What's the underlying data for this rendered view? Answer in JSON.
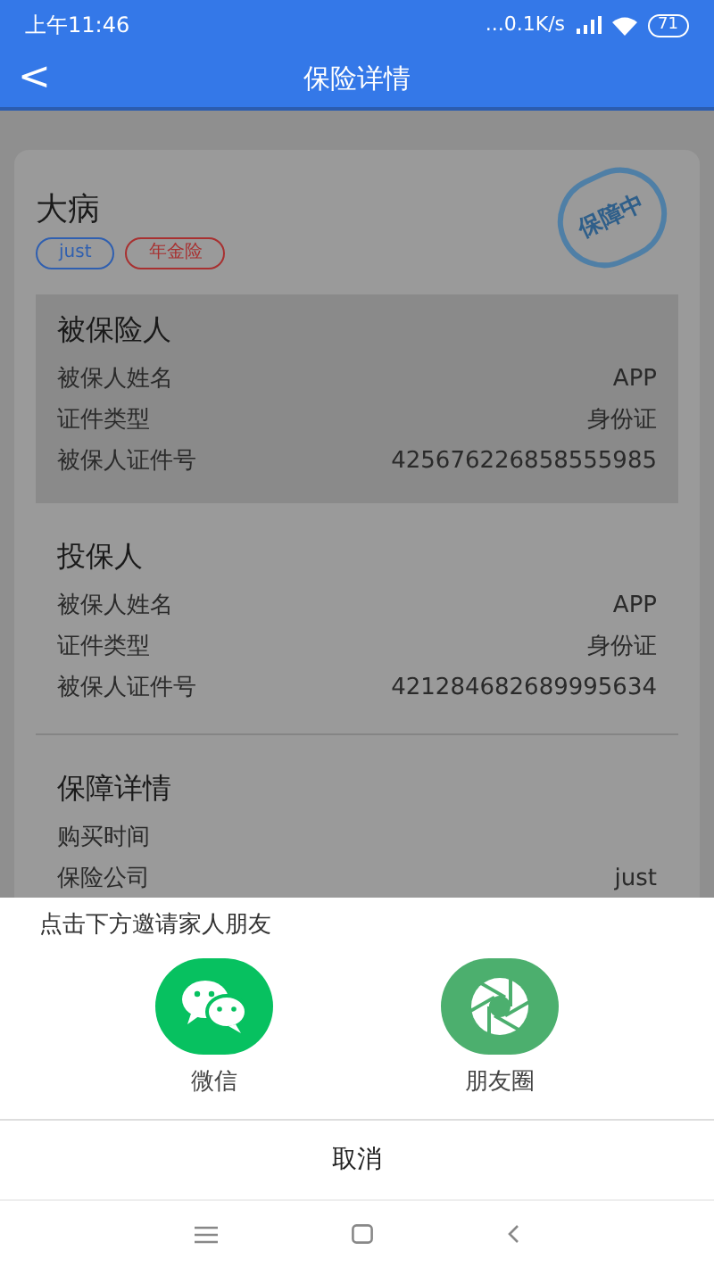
{
  "status_bar": {
    "time": "上午11:46",
    "speed": "...0.1K/s",
    "battery": "71"
  },
  "header": {
    "back": "<",
    "title": "保险详情"
  },
  "policy": {
    "name": "大病",
    "tags": [
      {
        "label": "just",
        "color": "#2f5fb0"
      },
      {
        "label": "年金险",
        "color": "#a83030"
      }
    ],
    "stamp": "保障中",
    "sections": [
      {
        "title": "被保险人",
        "shaded": true,
        "rows": [
          {
            "label": "被保人姓名",
            "value": "APP"
          },
          {
            "label": "证件类型",
            "value": "身份证"
          },
          {
            "label": "被保人证件号",
            "value": "425676226858555985"
          }
        ]
      },
      {
        "title": "投保人",
        "shaded": false,
        "rows": [
          {
            "label": "被保人姓名",
            "value": "APP"
          },
          {
            "label": "证件类型",
            "value": "身份证"
          },
          {
            "label": "被保人证件号",
            "value": "421284682689995634"
          }
        ]
      },
      {
        "title": "保障详情",
        "shaded": false,
        "rows": [
          {
            "label": "购买时间"
          },
          {
            "label": "保险公司",
            "value": "just"
          }
        ]
      }
    ]
  },
  "share_sheet": {
    "prompt": "点击下方邀请家人朋友",
    "options": [
      {
        "kind": "chat",
        "label": "微信"
      },
      {
        "kind": "moments",
        "label": "朋友圈"
      }
    ],
    "cancel": "取消"
  }
}
